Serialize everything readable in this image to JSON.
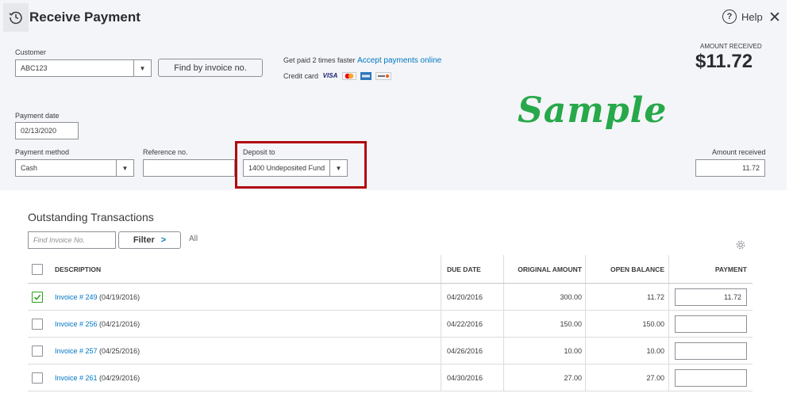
{
  "header": {
    "title": "Receive Payment",
    "help_label": "Help",
    "help_symbol": "?",
    "close_symbol": "✕"
  },
  "customer": {
    "label": "Customer",
    "value": "ABC123",
    "find_button": "Find by invoice no."
  },
  "promo": {
    "text": "Get paid 2 times faster",
    "link": "Accept payments online",
    "credit_card_label": "Credit card",
    "card_icons": [
      "visa-icon",
      "mastercard-icon",
      "amex-icon",
      "discover-icon"
    ],
    "visa_text": "VISA",
    "amex_text": "AMEX",
    "discover_text": "DISCOVER"
  },
  "amount": {
    "label": "AMOUNT RECEIVED",
    "value": "$11.72"
  },
  "watermark": "Sample",
  "payment_date": {
    "label": "Payment date",
    "value": "02/13/2020"
  },
  "payment_method": {
    "label": "Payment method",
    "value": "Cash"
  },
  "reference": {
    "label": "Reference no.",
    "value": ""
  },
  "deposit_to": {
    "label": "Deposit to",
    "value": "1400 Undeposited Fund"
  },
  "amount_received": {
    "label": "Amount received",
    "value": "11.72"
  },
  "outstanding": {
    "title": "Outstanding Transactions",
    "find_placeholder": "Find Invoice No.",
    "filter_label": "Filter",
    "all_label": "All",
    "columns": [
      "DESCRIPTION",
      "DUE DATE",
      "ORIGINAL AMOUNT",
      "OPEN BALANCE",
      "PAYMENT"
    ],
    "rows": [
      {
        "checked": true,
        "invoice": "Invoice # 249",
        "date": " (04/19/2016)",
        "due": "04/20/2016",
        "original": "300.00",
        "open": "11.72",
        "payment": "11.72"
      },
      {
        "checked": false,
        "invoice": "Invoice # 256",
        "date": " (04/21/2016)",
        "due": "04/22/2016",
        "original": "150.00",
        "open": "150.00",
        "payment": ""
      },
      {
        "checked": false,
        "invoice": "Invoice # 257",
        "date": " (04/25/2016)",
        "due": "04/26/2016",
        "original": "10.00",
        "open": "10.00",
        "payment": ""
      },
      {
        "checked": false,
        "invoice": "Invoice # 261",
        "date": " (04/29/2016)",
        "due": "04/30/2016",
        "original": "27.00",
        "open": "27.00",
        "payment": ""
      }
    ]
  },
  "colors": {
    "accent_link": "#0077c5",
    "check_green": "#2ca01c",
    "highlight_red": "#b0070f",
    "watermark_green": "#27a84a",
    "panel_bg": "#f4f5f8"
  }
}
